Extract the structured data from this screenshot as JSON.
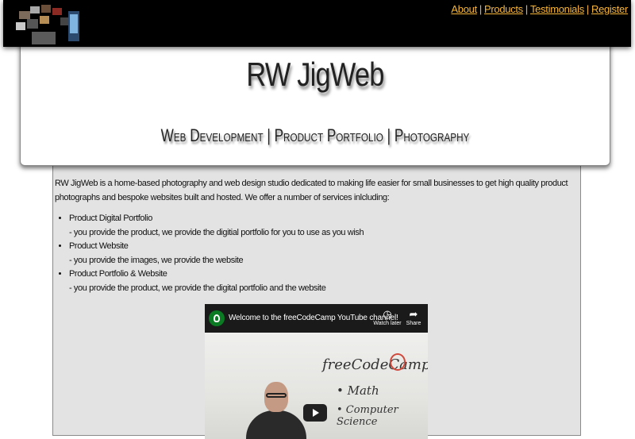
{
  "nav": {
    "items": [
      "About",
      "Products",
      "Testimonials",
      "Register"
    ],
    "separator": "|",
    "link_color": "#f7b63a"
  },
  "header": {
    "title": "RW JigWeb",
    "subtitle": "Web Development | Product Portfolio | Photography"
  },
  "main": {
    "intro": "RW JigWeb is a home-based photography and web design studio dedicated to making life easier for small businesses to get high quality product photographs and bespoke websites built and hosted. We offer a number of services inlcluding:",
    "services": [
      {
        "name": "Product Digital Portfolio",
        "desc": "- you provide the product, we provide the digitial portfolio for you to use as you wish"
      },
      {
        "name": "Product Website",
        "desc": "- you provide the images, we provide the website"
      },
      {
        "name": "Product Portfolio & Website",
        "desc": "- you provide the product, we provide the digital portfolio and the website"
      }
    ]
  },
  "video": {
    "title": "Welcome to the freeCodeCamp YouTube channel!",
    "watch_later": "Watch later",
    "share": "Share",
    "board_title": "freeCodeCamp",
    "board_item_1": "• Math",
    "board_item_2": "• Computer Science"
  }
}
